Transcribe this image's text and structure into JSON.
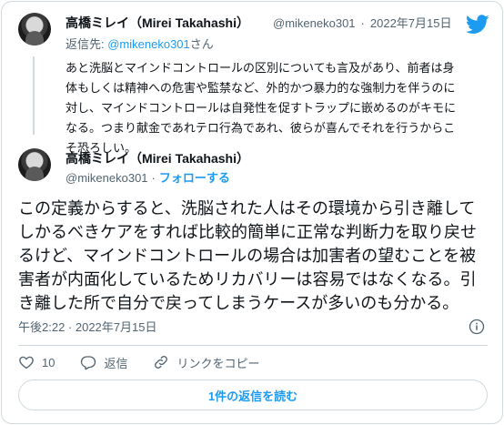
{
  "quoted": {
    "name": "高橋ミレイ（Mirei Takahashi）",
    "handle": "@mikeneko301",
    "separator": "·",
    "date": "2022年7月15日",
    "reply_prefix": "返信先: ",
    "reply_to": "@mikeneko301",
    "reply_suffix": "さん",
    "body": "あと洗脳とマインドコントロールの区別についても言及があり、前者は身体もしくは精神への危害や監禁など、外的かつ暴力的な強制力を伴うのに対し、マインドコントロールは自発性を促すトラップに嵌めるのがキモになる。つまり献金であれテロ行為であれ、彼らが喜んでそれを行うからこそ恐ろしい。"
  },
  "main": {
    "name": "高橋ミレイ（Mirei Takahashi）",
    "handle": "@mikeneko301",
    "separator": "·",
    "follow_label": "フォローする",
    "body": "この定義からすると、洗脳された人はその環境から引き離してしかるべきケアをすれば比較的簡単に正常な判断力を取り戻せるけど、マインドコントロールの場合は加害者の望むことを被害者が内面化しているためリカバリーは容易ではなくなる。引き離した所で自分で戻ってしまうケースが多いのも分かる。",
    "timestamp": "午後2:22 · 2022年7月15日"
  },
  "actions": {
    "like_count": "10",
    "reply_label": "返信",
    "copy_link_label": "リンクをコピー"
  },
  "read_replies_label": "1件の返信を読む",
  "colors": {
    "accent": "#1d9bf0",
    "muted": "#536471",
    "border": "#cfd9de"
  },
  "icons": [
    "twitter-bird-icon",
    "info-icon",
    "heart-icon",
    "reply-bubble-icon",
    "link-icon"
  ]
}
